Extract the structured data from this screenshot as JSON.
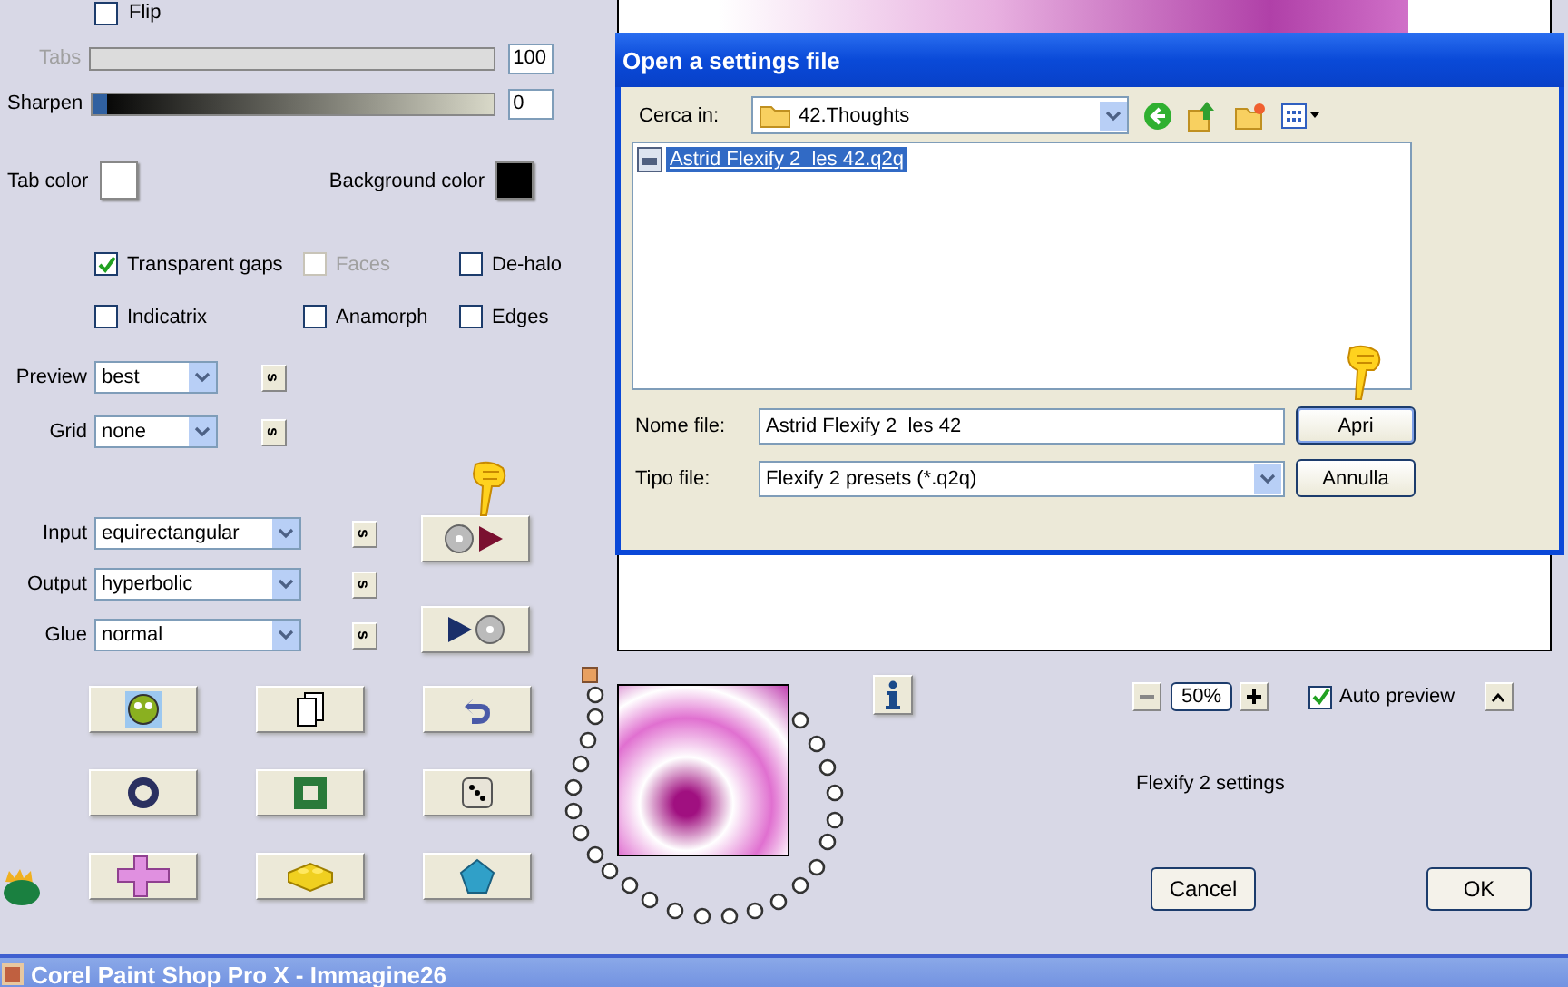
{
  "left_panel": {
    "flip": {
      "label": "Flip",
      "checked": false
    },
    "sliders": [
      {
        "label": "Tabs",
        "value": "100",
        "disabled": true
      },
      {
        "label": "Sharpen",
        "value": "0",
        "level": 0,
        "disabled": false
      }
    ],
    "colors": [
      {
        "label": "Tab color",
        "color": "#ffffff"
      },
      {
        "label": "Background color",
        "color": "#000000"
      }
    ],
    "options": [
      {
        "label": "Transparent gaps",
        "checked": true,
        "disabled": false
      },
      {
        "label": "Faces",
        "checked": false,
        "disabled": true
      },
      {
        "label": "De-halo",
        "checked": false,
        "disabled": false
      },
      {
        "label": "Indicatrix",
        "checked": false,
        "disabled": false
      },
      {
        "label": "Anamorph",
        "checked": false,
        "disabled": false
      },
      {
        "label": "Edges",
        "checked": false,
        "disabled": false
      }
    ],
    "view_selects": [
      {
        "label": "Preview",
        "value": "best",
        "lock": "s"
      },
      {
        "label": "Grid",
        "value": "none",
        "lock": "s"
      }
    ],
    "mapping_selects": [
      {
        "label": "Input",
        "value": "equirectangular",
        "lock": "s"
      },
      {
        "label": "Output",
        "value": "hyperbolic",
        "lock": "s"
      },
      {
        "label": "Glue",
        "value": "normal",
        "lock": "s"
      }
    ],
    "preset_buttons": [
      {
        "kind": "load"
      },
      {
        "kind": "save"
      }
    ],
    "tool_buttons": [
      {
        "kind": "gremlin"
      },
      {
        "kind": "pages"
      },
      {
        "kind": "undo"
      },
      {
        "kind": "ring"
      },
      {
        "kind": "frame"
      },
      {
        "kind": "dice"
      },
      {
        "kind": "cross"
      },
      {
        "kind": "brick"
      },
      {
        "kind": "pentagon"
      }
    ]
  },
  "preview": {
    "zoom": "50%",
    "auto_preview": {
      "label": "Auto preview",
      "checked": true
    },
    "caption": "Flexify 2 settings",
    "buttons": [
      "Cancel",
      "OK"
    ]
  },
  "dialog": {
    "title": "Open a settings file",
    "look_in": {
      "label": "Cerca in:",
      "value": "42.Thoughts"
    },
    "files": [
      {
        "name": "Astrid Flexify 2  les 42.q2q",
        "selected": true
      }
    ],
    "file_name": {
      "label": "Nome file:",
      "value": "Astrid Flexify 2  les 42"
    },
    "file_type": {
      "label": "Tipo file:",
      "value": "Flexify 2 presets (*.q2q)"
    },
    "buttons": [
      "Apri",
      "Annulla"
    ]
  },
  "taskbar": {
    "title": "Corel Paint Shop Pro X - Immagine26"
  }
}
